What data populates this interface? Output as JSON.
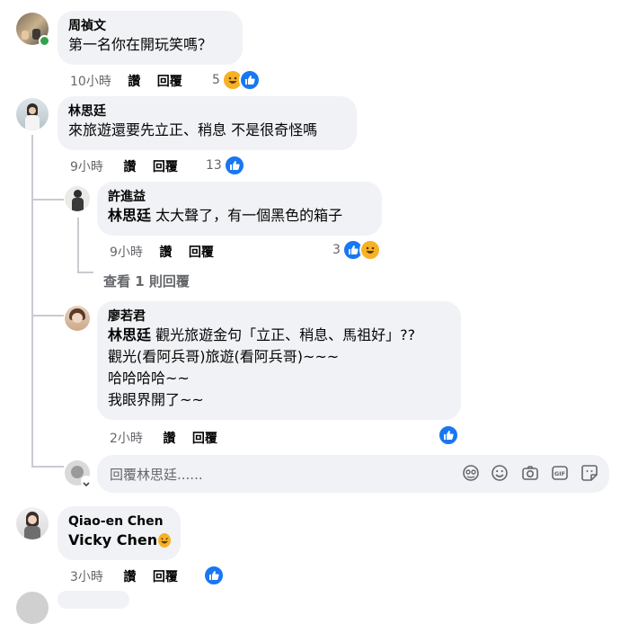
{
  "comments": [
    {
      "author": "周禎文",
      "text": "第一名你在開玩笑嗎？",
      "time": "10小時",
      "like_label": "讚",
      "reply_label": "回覆",
      "reaction_count": "5"
    },
    {
      "author": "林思廷",
      "text": "來旅遊還要先立正、稍息 不是很奇怪嗎",
      "time": "9小時",
      "like_label": "讚",
      "reply_label": "回覆",
      "reaction_count": "13"
    },
    {
      "author": "Qiao-en Chen",
      "text": "Vicky Chen",
      "time": "3小時",
      "like_label": "讚",
      "reply_label": "回覆"
    }
  ],
  "replies": [
    {
      "author": "許進益",
      "mention": "林思廷",
      "text": " 太大聲了，有一個黑色的箱子",
      "time": "9小時",
      "like_label": "讚",
      "reply_label": "回覆",
      "reaction_count": "3",
      "view_more": "查看 1 則回覆"
    },
    {
      "author": "廖若君",
      "mention": "林思廷",
      "line1": " 觀光旅遊金句「立正、稍息、馬祖好」??",
      "line2": "觀光(看阿兵哥)旅遊(看阿兵哥)~~~",
      "line3": "哈哈哈哈~~",
      "line4": "我眼界開了~~",
      "time": "2小時",
      "like_label": "讚",
      "reply_label": "回覆"
    }
  ],
  "reply_input": {
    "placeholder": "回覆林思廷......"
  },
  "colors": {
    "bubble": "#f0f2f5",
    "like_blue": "#1877f2",
    "haha_yellow": "#f7b125",
    "meta_gray": "#65676b",
    "online_green": "#31a24c"
  },
  "icons": [
    "like-reaction-icon",
    "haha-reaction-icon",
    "emoji-icon",
    "camera-icon",
    "gif-icon",
    "sticker-icon",
    "avatar-sticker-icon"
  ]
}
